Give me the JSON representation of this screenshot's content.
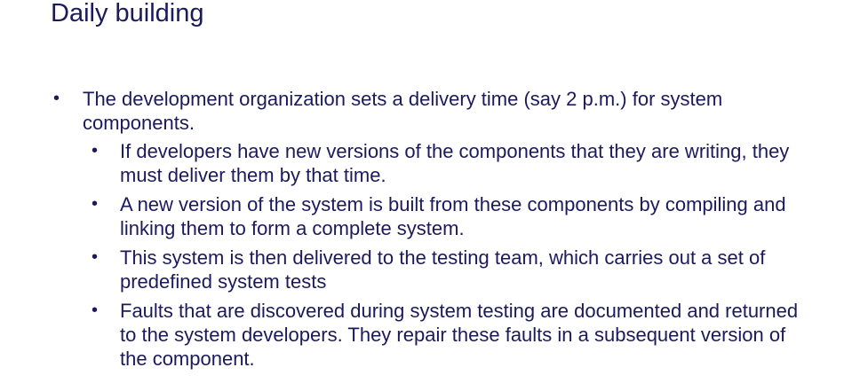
{
  "slide": {
    "title": "Daily building",
    "bullets": [
      {
        "text": "The development organization sets a delivery time (say 2 p.m.) for system components.",
        "sub": [
          "If developers have new versions of the components that they are writing, they must deliver them by that time.",
          "A new version of the system is built from these components by compiling and linking them to form a complete system.",
          "This system is then delivered to the testing team, which carries out a set of predefined system tests",
          "Faults that are discovered during system testing are documented and returned to the system developers. They repair these faults in a subsequent version of the component."
        ]
      }
    ],
    "bullet_glyph": "•"
  }
}
